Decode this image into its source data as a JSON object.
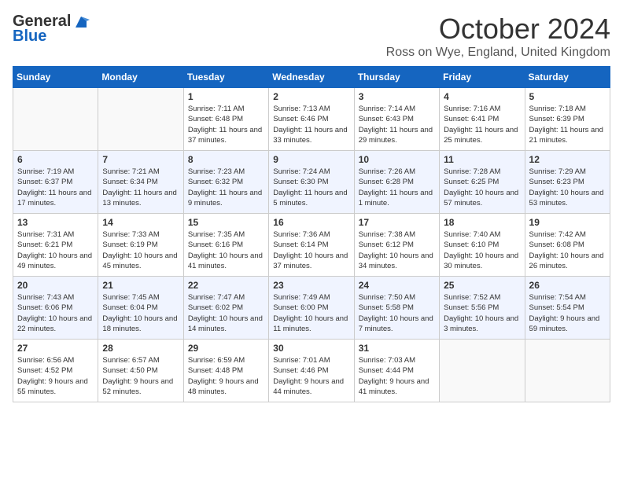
{
  "logo": {
    "general": "General",
    "blue": "Blue"
  },
  "title": "October 2024",
  "subtitle": "Ross on Wye, England, United Kingdom",
  "weekdays": [
    "Sunday",
    "Monday",
    "Tuesday",
    "Wednesday",
    "Thursday",
    "Friday",
    "Saturday"
  ],
  "weeks": [
    [
      {
        "day": "",
        "info": ""
      },
      {
        "day": "",
        "info": ""
      },
      {
        "day": "1",
        "info": "Sunrise: 7:11 AM\nSunset: 6:48 PM\nDaylight: 11 hours and 37 minutes."
      },
      {
        "day": "2",
        "info": "Sunrise: 7:13 AM\nSunset: 6:46 PM\nDaylight: 11 hours and 33 minutes."
      },
      {
        "day": "3",
        "info": "Sunrise: 7:14 AM\nSunset: 6:43 PM\nDaylight: 11 hours and 29 minutes."
      },
      {
        "day": "4",
        "info": "Sunrise: 7:16 AM\nSunset: 6:41 PM\nDaylight: 11 hours and 25 minutes."
      },
      {
        "day": "5",
        "info": "Sunrise: 7:18 AM\nSunset: 6:39 PM\nDaylight: 11 hours and 21 minutes."
      }
    ],
    [
      {
        "day": "6",
        "info": "Sunrise: 7:19 AM\nSunset: 6:37 PM\nDaylight: 11 hours and 17 minutes."
      },
      {
        "day": "7",
        "info": "Sunrise: 7:21 AM\nSunset: 6:34 PM\nDaylight: 11 hours and 13 minutes."
      },
      {
        "day": "8",
        "info": "Sunrise: 7:23 AM\nSunset: 6:32 PM\nDaylight: 11 hours and 9 minutes."
      },
      {
        "day": "9",
        "info": "Sunrise: 7:24 AM\nSunset: 6:30 PM\nDaylight: 11 hours and 5 minutes."
      },
      {
        "day": "10",
        "info": "Sunrise: 7:26 AM\nSunset: 6:28 PM\nDaylight: 11 hours and 1 minute."
      },
      {
        "day": "11",
        "info": "Sunrise: 7:28 AM\nSunset: 6:25 PM\nDaylight: 10 hours and 57 minutes."
      },
      {
        "day": "12",
        "info": "Sunrise: 7:29 AM\nSunset: 6:23 PM\nDaylight: 10 hours and 53 minutes."
      }
    ],
    [
      {
        "day": "13",
        "info": "Sunrise: 7:31 AM\nSunset: 6:21 PM\nDaylight: 10 hours and 49 minutes."
      },
      {
        "day": "14",
        "info": "Sunrise: 7:33 AM\nSunset: 6:19 PM\nDaylight: 10 hours and 45 minutes."
      },
      {
        "day": "15",
        "info": "Sunrise: 7:35 AM\nSunset: 6:16 PM\nDaylight: 10 hours and 41 minutes."
      },
      {
        "day": "16",
        "info": "Sunrise: 7:36 AM\nSunset: 6:14 PM\nDaylight: 10 hours and 37 minutes."
      },
      {
        "day": "17",
        "info": "Sunrise: 7:38 AM\nSunset: 6:12 PM\nDaylight: 10 hours and 34 minutes."
      },
      {
        "day": "18",
        "info": "Sunrise: 7:40 AM\nSunset: 6:10 PM\nDaylight: 10 hours and 30 minutes."
      },
      {
        "day": "19",
        "info": "Sunrise: 7:42 AM\nSunset: 6:08 PM\nDaylight: 10 hours and 26 minutes."
      }
    ],
    [
      {
        "day": "20",
        "info": "Sunrise: 7:43 AM\nSunset: 6:06 PM\nDaylight: 10 hours and 22 minutes."
      },
      {
        "day": "21",
        "info": "Sunrise: 7:45 AM\nSunset: 6:04 PM\nDaylight: 10 hours and 18 minutes."
      },
      {
        "day": "22",
        "info": "Sunrise: 7:47 AM\nSunset: 6:02 PM\nDaylight: 10 hours and 14 minutes."
      },
      {
        "day": "23",
        "info": "Sunrise: 7:49 AM\nSunset: 6:00 PM\nDaylight: 10 hours and 11 minutes."
      },
      {
        "day": "24",
        "info": "Sunrise: 7:50 AM\nSunset: 5:58 PM\nDaylight: 10 hours and 7 minutes."
      },
      {
        "day": "25",
        "info": "Sunrise: 7:52 AM\nSunset: 5:56 PM\nDaylight: 10 hours and 3 minutes."
      },
      {
        "day": "26",
        "info": "Sunrise: 7:54 AM\nSunset: 5:54 PM\nDaylight: 9 hours and 59 minutes."
      }
    ],
    [
      {
        "day": "27",
        "info": "Sunrise: 6:56 AM\nSunset: 4:52 PM\nDaylight: 9 hours and 55 minutes."
      },
      {
        "day": "28",
        "info": "Sunrise: 6:57 AM\nSunset: 4:50 PM\nDaylight: 9 hours and 52 minutes."
      },
      {
        "day": "29",
        "info": "Sunrise: 6:59 AM\nSunset: 4:48 PM\nDaylight: 9 hours and 48 minutes."
      },
      {
        "day": "30",
        "info": "Sunrise: 7:01 AM\nSunset: 4:46 PM\nDaylight: 9 hours and 44 minutes."
      },
      {
        "day": "31",
        "info": "Sunrise: 7:03 AM\nSunset: 4:44 PM\nDaylight: 9 hours and 41 minutes."
      },
      {
        "day": "",
        "info": ""
      },
      {
        "day": "",
        "info": ""
      }
    ]
  ]
}
